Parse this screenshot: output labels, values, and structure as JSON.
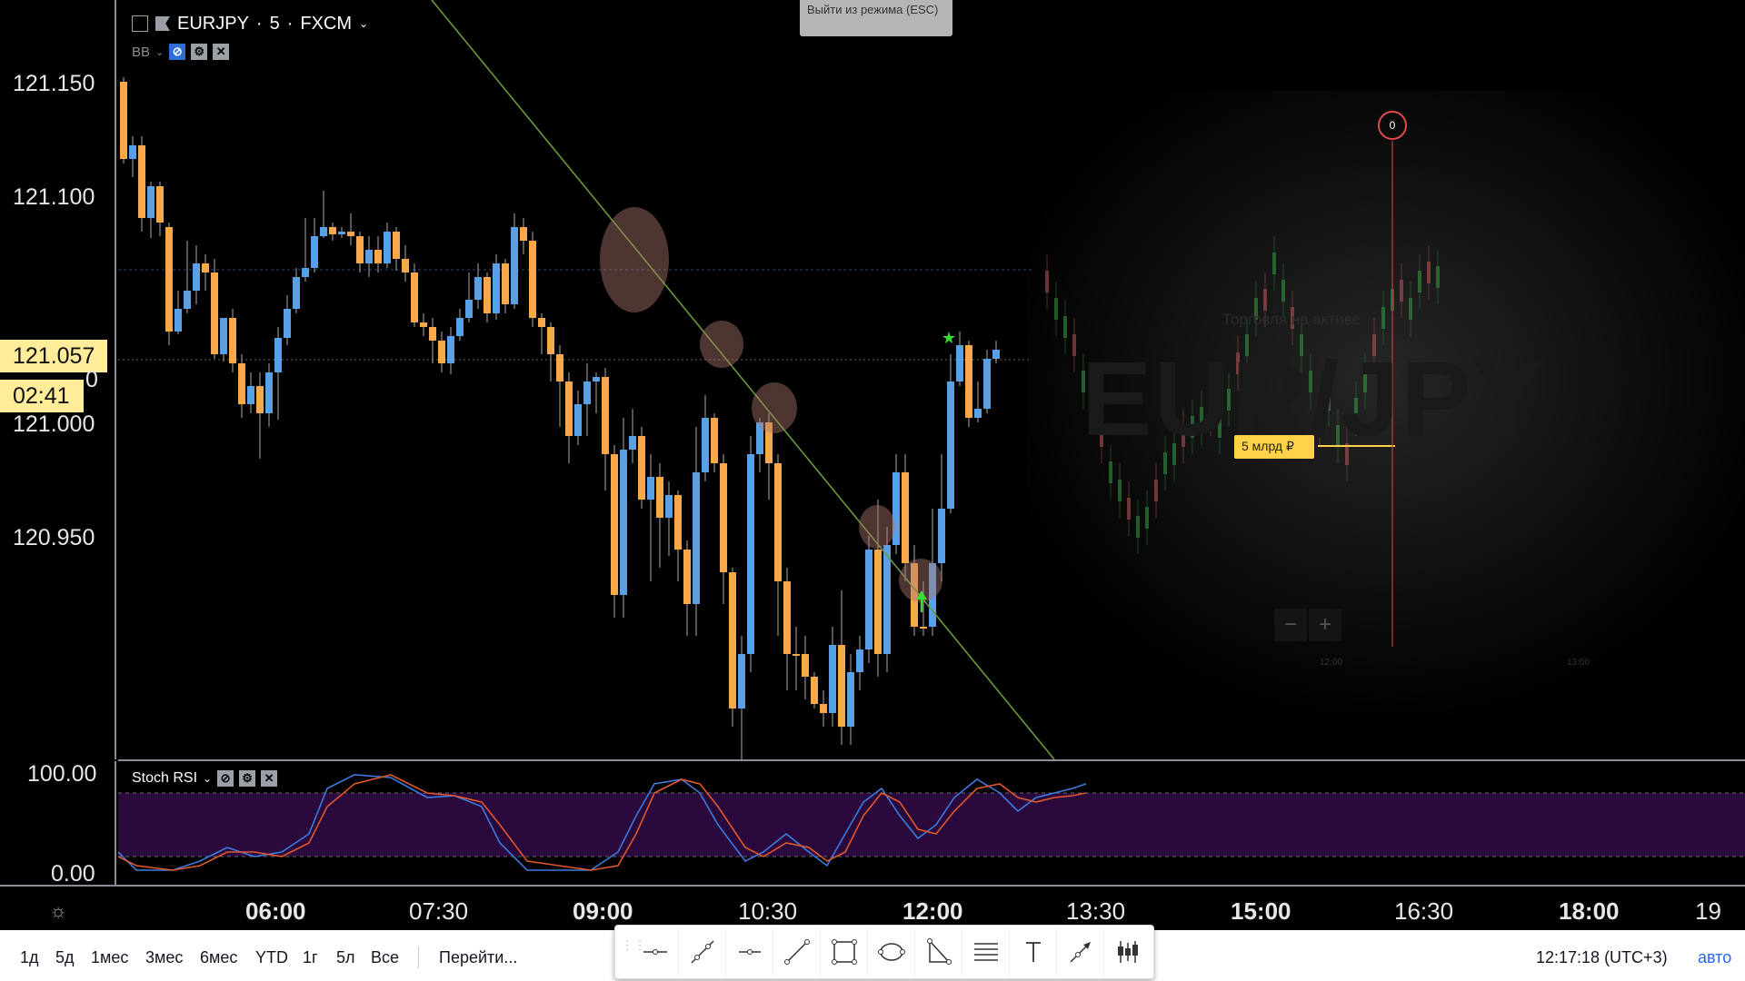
{
  "symbol": {
    "ticker": "EURJPY",
    "interval": "5",
    "exchange": "FXCM",
    "indicator_abbr": "BB"
  },
  "exit_tooltip": "Выйти из режима (ESC)",
  "price_axis": {
    "ticks": [
      "121.150",
      "121.100",
      "121.000",
      "120.950"
    ],
    "current_price": "121.057",
    "countdown": "02:41",
    "hidden_tick_fragment": "0"
  },
  "stoch": {
    "name": "Stoch RSI",
    "axis": [
      "100.00",
      "0.00"
    ]
  },
  "overlay": {
    "watermark": "EUR/JPY",
    "subtitle": "Торговля на активе",
    "amount_badge": "5 млрд ₽",
    "marker": "0",
    "time1": "12:00",
    "time2": "13:00"
  },
  "time_axis": [
    {
      "label": "06:00",
      "bold": true
    },
    {
      "label": "07:30",
      "bold": false
    },
    {
      "label": "09:00",
      "bold": true
    },
    {
      "label": "10:30",
      "bold": false
    },
    {
      "label": "12:00",
      "bold": true
    },
    {
      "label": "13:30",
      "bold": false
    },
    {
      "label": "15:00",
      "bold": true
    },
    {
      "label": "16:30",
      "bold": false
    },
    {
      "label": "18:00",
      "bold": true
    },
    {
      "label": "19",
      "bold": false
    }
  ],
  "ranges": [
    "1д",
    "5д",
    "1мес",
    "3мес",
    "6мес",
    "YTD",
    "1г",
    "5л",
    "Все"
  ],
  "goto_label": "Перейти...",
  "clock": "12:17:18 (UTC+3)",
  "auto_label": "авто",
  "colors": {
    "up": "#5aa0e6",
    "down": "#f7a84b",
    "trend": "#6a9a3a",
    "stoch_k": "#3d7ae0",
    "stoch_d": "#e0572b",
    "band": "#2a0a3c"
  },
  "zoom": {
    "minus": "−",
    "plus": "+"
  },
  "tools": [
    "horizontal-line",
    "trend-line",
    "horizontal-ray",
    "line",
    "rectangle",
    "ellipse",
    "triangle",
    "fib-retracement",
    "text",
    "arrow",
    "long-position"
  ]
}
